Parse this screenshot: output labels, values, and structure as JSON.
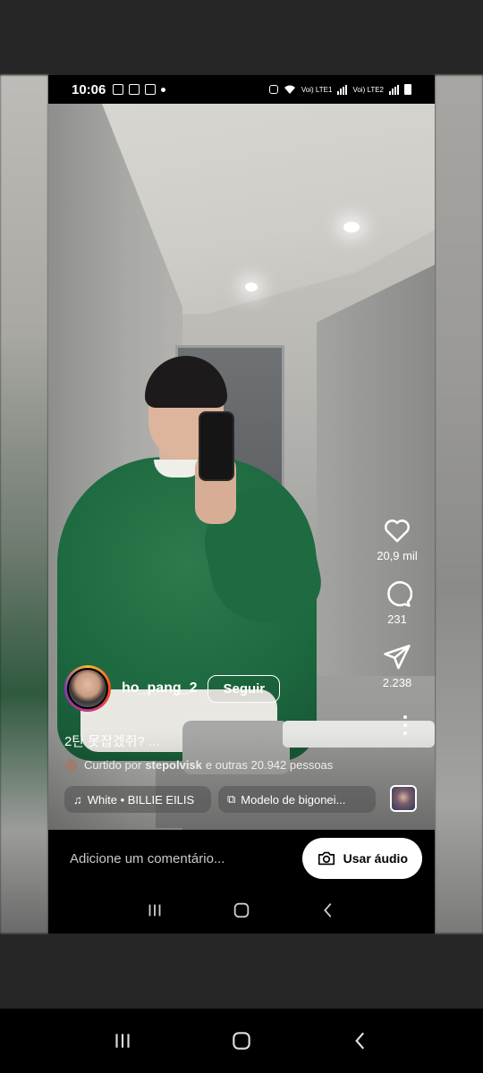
{
  "status_bar": {
    "time": "10:06",
    "carrier1": "Voi) LTE1",
    "carrier2": "Voi) LTE2"
  },
  "reel": {
    "actions": {
      "likes": "20,9 mil",
      "comments": "231",
      "shares": "2.238"
    },
    "username": "ho_pang_2",
    "follow_label": "Seguir",
    "caption": "2탄 못잡겠쥐? ...",
    "liked_by": {
      "prefix": "Curtido por",
      "user": "stepolvisk",
      "suffix": "e outras 20.942 pessoas"
    },
    "music_tag": "White • BILLIE EILIS",
    "effect_tag": "Modelo de bigonei..."
  },
  "comment_bar": {
    "placeholder": "Adicione um comentário...",
    "use_audio_label": "Usar áudio"
  },
  "icons": {
    "like": "heart-icon",
    "comment": "comment-icon",
    "share": "send-icon",
    "more": "more-vertical-icon",
    "music": "music-note-icon",
    "effect": "effects-icon",
    "camera": "camera-icon",
    "recents": "recents-icon",
    "home": "home-icon",
    "back": "back-icon"
  }
}
